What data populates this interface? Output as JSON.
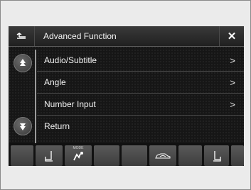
{
  "header": {
    "title": "Advanced Function"
  },
  "menu": {
    "items": [
      {
        "label": "Audio/Subtitle",
        "chevron": ">"
      },
      {
        "label": "Angle",
        "chevron": ">"
      },
      {
        "label": "Number Input",
        "chevron": ">"
      },
      {
        "label": "Return"
      }
    ]
  },
  "bottom_bar": {
    "mode_label": "MODE"
  },
  "colors": {
    "screen_bg": "#161616",
    "text": "#f2f2f2",
    "button": "#4a4a4a"
  },
  "icons": [
    "back-arrow-icon",
    "close-icon",
    "scroll-up-icon",
    "scroll-down-icon",
    "seat-left-icon",
    "fan-mode-icon",
    "car-recirculation-icon",
    "seat-right-icon"
  ]
}
